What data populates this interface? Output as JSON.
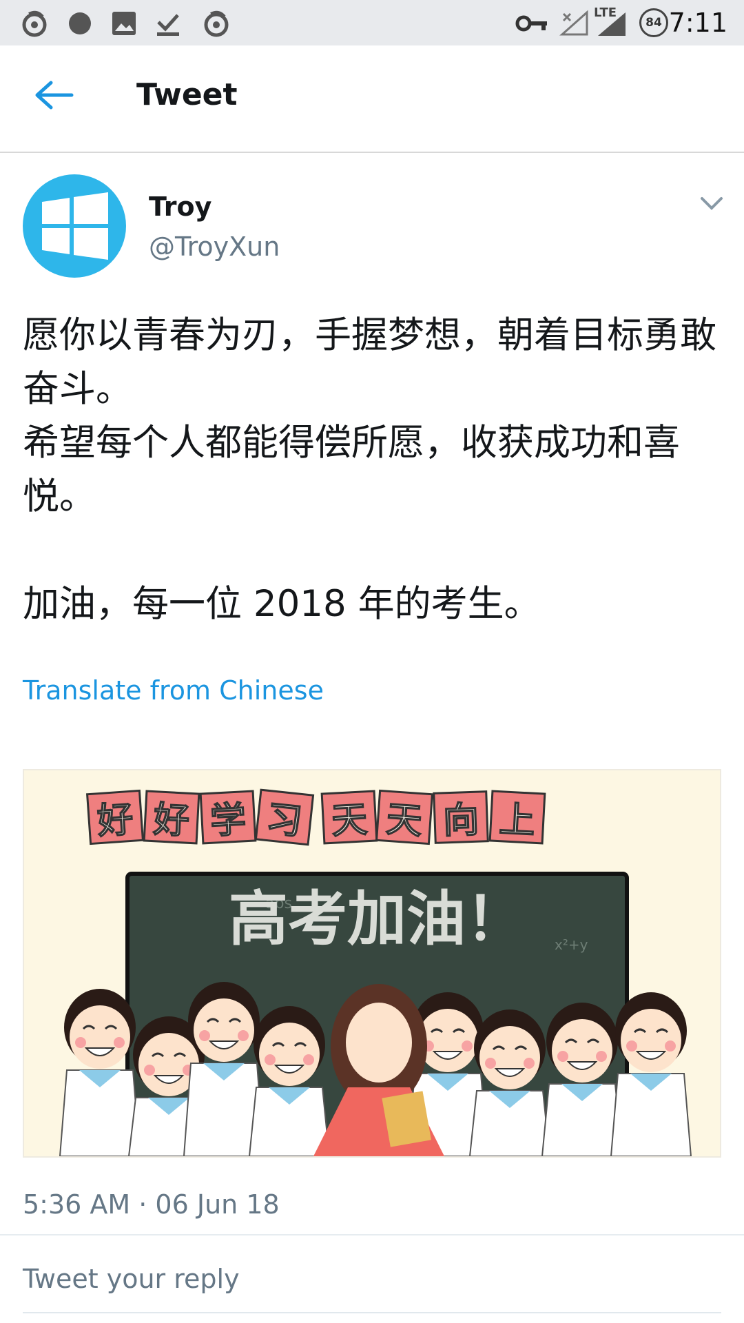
{
  "status_bar": {
    "time": "7:11",
    "network": "LTE",
    "battery": "84",
    "icons": [
      "weibo-icon",
      "record-icon",
      "image-icon",
      "download-done-icon",
      "weibo-icon",
      "vpn-key-icon",
      "wifi-off-icon",
      "signal-icon",
      "battery-icon"
    ]
  },
  "header": {
    "title": "Tweet"
  },
  "author": {
    "name": "Troy",
    "handle": "@TroyXun"
  },
  "tweet": {
    "text": "愿你以青春为刃，手握梦想，朝着目标勇敢奋斗。\n希望每个人都能得偿所愿，收获成功和喜悦。\n\n加油，每一位 2018 年的考生。",
    "translate_label": "Translate from Chinese",
    "timestamp": "5:36 AM · 06 Jun 18"
  },
  "media": {
    "banner_chars": [
      "好",
      "好",
      "学",
      "习",
      "天",
      "天",
      "向",
      "上"
    ],
    "board_text": "高考加油！"
  },
  "reply": {
    "placeholder": "Tweet your reply"
  },
  "colors": {
    "accent": "#1b95e0",
    "avatar": "#2eb6ea",
    "secondary_text": "#657786"
  }
}
